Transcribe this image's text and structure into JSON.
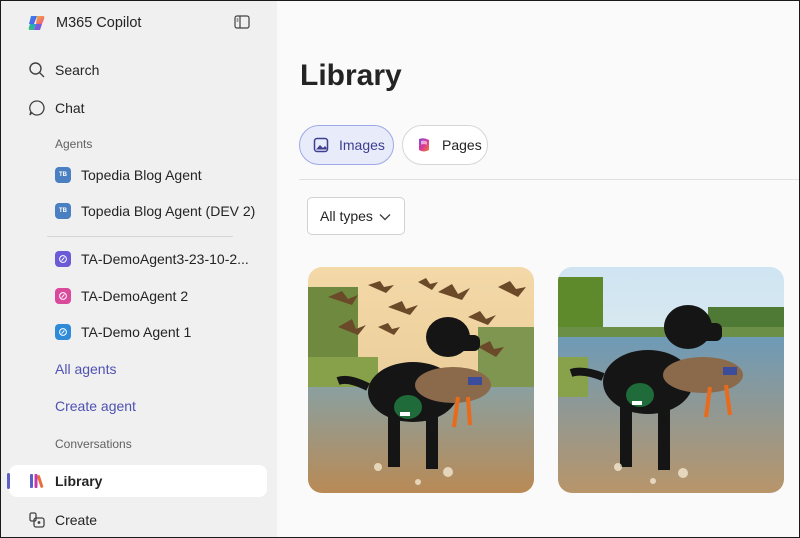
{
  "app": {
    "title": "M365 Copilot"
  },
  "sidebar": {
    "search_label": "Search",
    "chat_label": "Chat",
    "agents_section": "Agents",
    "agents": [
      {
        "label": "Topedia Blog Agent",
        "badge": "TB",
        "color": "#4a7fc1"
      },
      {
        "label": "Topedia Blog Agent (DEV 2)",
        "badge": "TB",
        "color": "#4a7fc1"
      },
      {
        "label": "TA-DemoAgent3-23-10-2...",
        "badge": "",
        "color": "#6b5bd6"
      },
      {
        "label": "TA-DemoAgent 2",
        "badge": "",
        "color": "#d94a9c"
      },
      {
        "label": "TA-Demo Agent 1",
        "badge": "",
        "color": "#2f8ad8"
      }
    ],
    "all_agents_label": "All agents",
    "create_agent_label": "Create agent",
    "conversations_section": "Conversations",
    "library_label": "Library",
    "create_label": "Create"
  },
  "main": {
    "title": "Library",
    "tabs": [
      {
        "label": "Images",
        "selected": true
      },
      {
        "label": "Pages",
        "selected": false
      }
    ],
    "filter": {
      "value": "All types"
    }
  },
  "colors": {
    "accent": "#5b5fc7",
    "link": "#4f52b2",
    "selected_tab_bg": "#e8ebfa"
  }
}
